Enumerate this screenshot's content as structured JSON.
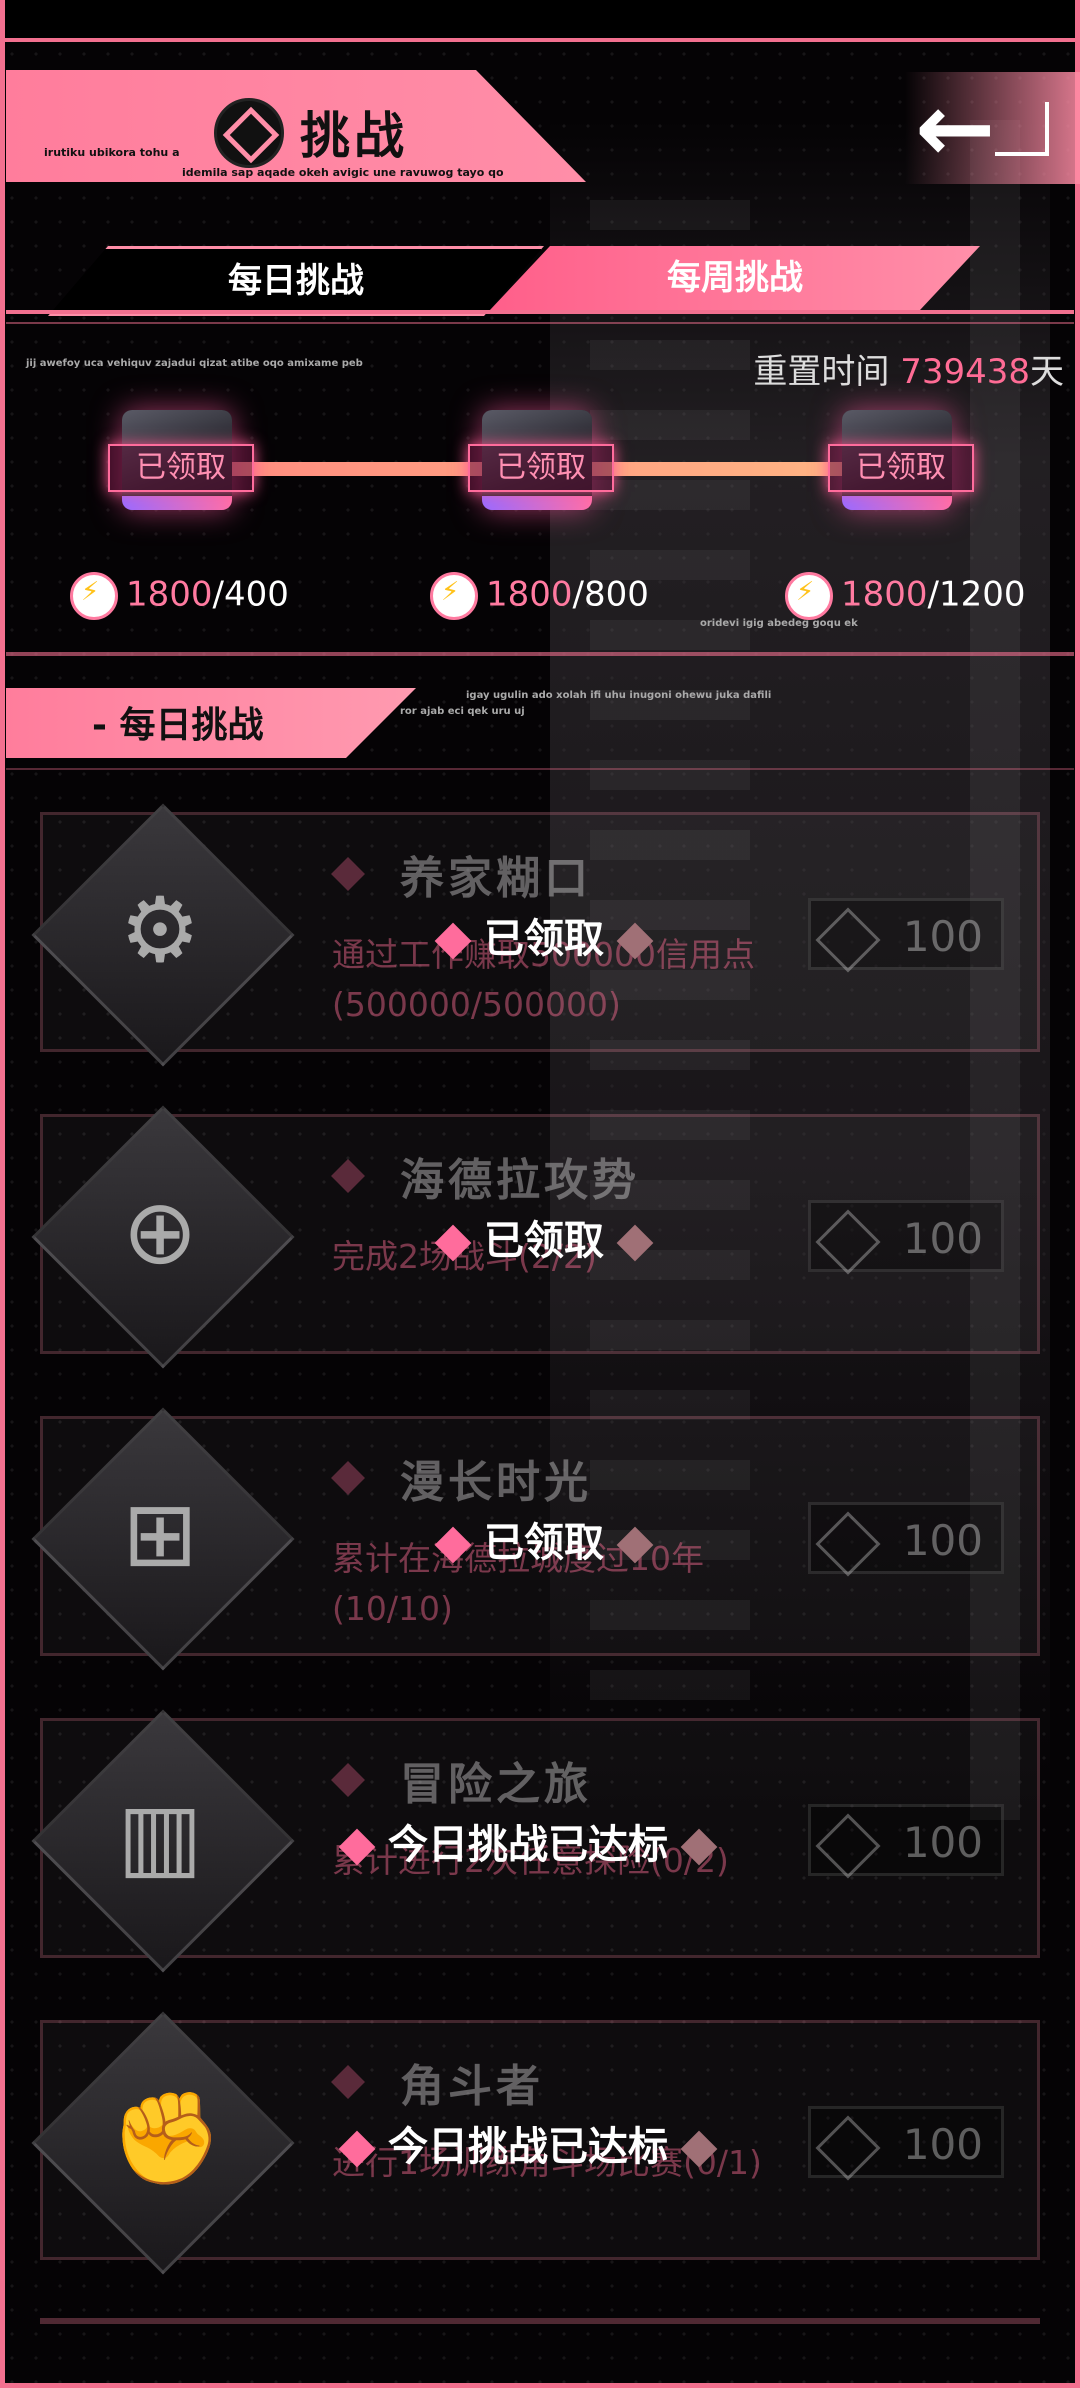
{
  "header": {
    "title": "挑战",
    "sub_line1": "irutiku ubikora tohu a",
    "sub_line2": "idemila sap aqade okeh avigic une ravuwog tayo qo",
    "back_icon": "back-arrow-icon"
  },
  "tabs": [
    {
      "label": "每日挑战",
      "active": false
    },
    {
      "label": "每周挑战",
      "active": true
    }
  ],
  "progress": {
    "reset_label": "重置时间",
    "reset_value": "739438",
    "reset_unit": "天",
    "flavor_top": "jij awefoy uca vehiquv zajadui qizat atibe oqo amixame peb",
    "flavor_bottom": "oridevi igig abedeg goqu ek",
    "chests": [
      {
        "status": "已领取",
        "current": "1800",
        "target": "/400"
      },
      {
        "status": "已领取",
        "current": "1800",
        "target": "/800"
      },
      {
        "status": "已领取",
        "current": "1800",
        "target": "/1200"
      }
    ]
  },
  "section": {
    "title": "- 每日挑战",
    "flavor1": "igay ugulin ado xolah ifi uhu inugoni ohewu juka dafili",
    "flavor2": "ror ajab eci qek uru uj"
  },
  "challenges": [
    {
      "name": "养家糊口",
      "desc": "通过工作赚取500000信用点(500000/500000)",
      "reward": "100",
      "status": "已领取",
      "icon": "gear-hand-icon"
    },
    {
      "name": "海德拉攻势",
      "desc": "完成2场战斗(2/2)",
      "reward": "100",
      "status": "已领取",
      "icon": "crosshair-rifle-icon"
    },
    {
      "name": "漫长时光",
      "desc": "累计在海德拉城度过10年(10/10)",
      "reward": "100",
      "status": "已领取",
      "icon": "emblem-icon"
    },
    {
      "name": "冒险之旅",
      "desc": "累计进行2次任意探险(0/2)",
      "reward": "100",
      "status": "今日挑战已达标",
      "icon": "city-icon"
    },
    {
      "name": "角斗者",
      "desc": "进行1场训练角斗场比赛(0/1)",
      "reward": "100",
      "status": "今日挑战已达标",
      "icon": "muscle-arm-icon"
    }
  ]
}
